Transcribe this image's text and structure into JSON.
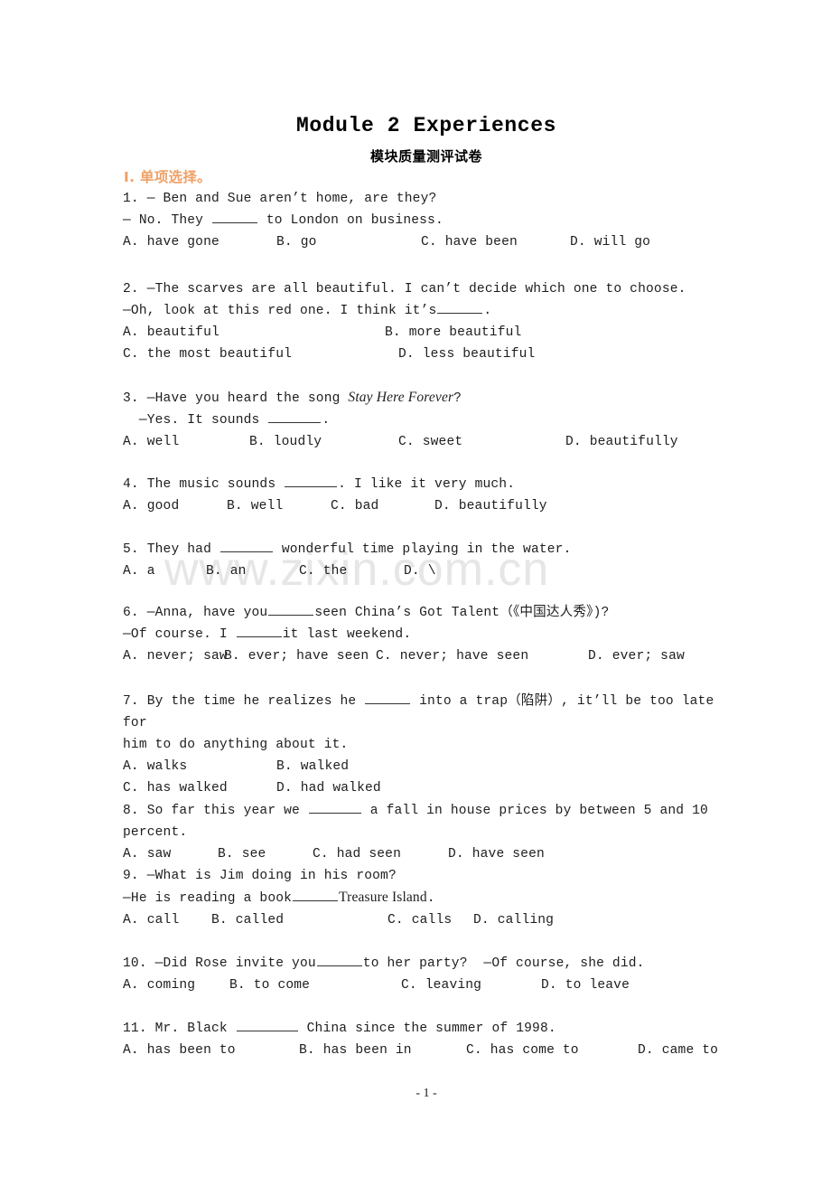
{
  "document": {
    "title": "Module 2 Experiences",
    "subtitle": "模块质量测评试卷",
    "section_heading": "I. 单项选择。",
    "section_heading_color": "#efa066",
    "footer": "- 1 -",
    "watermark": "www.zixin.com.cn",
    "watermark_color": "#e6e6e6"
  },
  "questions": [
    {
      "number": "1.",
      "stem_line_1": "1. — Ben and Sue aren’t home, are they?",
      "stem_line_2_pre": "— No. They ",
      "stem_line_2_post": " to London on business.",
      "options": [
        "A. have gone",
        "B. go",
        "C. have been",
        "D. will go"
      ]
    },
    {
      "number": "2.",
      "stem_line_1": "2. —The scarves are all beautiful. I can’t decide which one to choose.",
      "stem_line_2_pre": "—Oh, look at this red one. I think it’s",
      "stem_line_2_post": ".",
      "options": [
        "A. beautiful",
        "B. more beautiful",
        "C. the most beautiful",
        "D. less beautiful"
      ]
    },
    {
      "number": "3.",
      "stem_line_1_pre": "3. —Have you heard the song ",
      "stem_line_1_italic": "Stay Here Forever",
      "stem_line_1_post": "?",
      "stem_line_2_pre": "  —Yes. It sounds ",
      "stem_line_2_post": ".",
      "options": [
        "A. well",
        "B. loudly",
        "C. sweet",
        "D. beautifully"
      ]
    },
    {
      "number": "4.",
      "stem_line_1_pre": "4. The music sounds ",
      "stem_line_1_post": ". I like it very much.",
      "options": [
        "A. good",
        "B. well",
        "C. bad",
        "D. beautifully"
      ]
    },
    {
      "number": "5.",
      "stem_line_1_pre": "5. They had ",
      "stem_line_1_post": " wonderful time playing in the water.",
      "options": [
        "A. a",
        "B. an",
        "C. the",
        "D. \\"
      ]
    },
    {
      "number": "6.",
      "stem_line_1_pre": "6. —Anna, have you",
      "stem_line_1_post": "seen China’s Got Talent（《中国达人秀》)?",
      "stem_line_2_pre": "—Of course. I ",
      "stem_line_2_post": "it last weekend.",
      "options": [
        "A. never; saw",
        "B. ever; have seen",
        "C. never; have seen",
        "D. ever; saw"
      ]
    },
    {
      "number": "7.",
      "stem_line_1_pre": "7. By the time he realizes he ",
      "stem_line_1_post": " into a trap（陷阱）, it’ll be too late for",
      "stem_line_2": "him to do anything about it.",
      "options": [
        "A. walks",
        "B. walked",
        "C. has walked",
        "D. had walked"
      ]
    },
    {
      "number": "8.",
      "stem_line_1_pre": "8. So far this year we ",
      "stem_line_1_post": " a fall in house prices by between 5 and 10 percent.",
      "options": [
        "A. saw",
        "B. see",
        "C. had seen",
        "D. have seen"
      ]
    },
    {
      "number": "9.",
      "stem_line_1": "9. —What is Jim doing in his room?",
      "stem_line_2_pre": "—He is reading a book",
      "stem_line_2_italic": "Treasure Island",
      "stem_line_2_post": ".",
      "options": [
        "A. call",
        "B. called",
        "C. calls",
        "D. calling"
      ]
    },
    {
      "number": "10.",
      "stem_line_1_pre": "10. —Did Rose invite you",
      "stem_line_1_post": "to her party?  —Of course, she did.",
      "options": [
        "A. coming",
        "B. to come",
        "C. leaving",
        "D. to leave"
      ]
    },
    {
      "number": "11.",
      "stem_line_1_pre": "11. Mr. Black ",
      "stem_line_1_post": " China since the summer of 1998.",
      "options": [
        "A. has been to",
        "B. has been in",
        "C. has come to",
        "D. came to"
      ]
    }
  ]
}
